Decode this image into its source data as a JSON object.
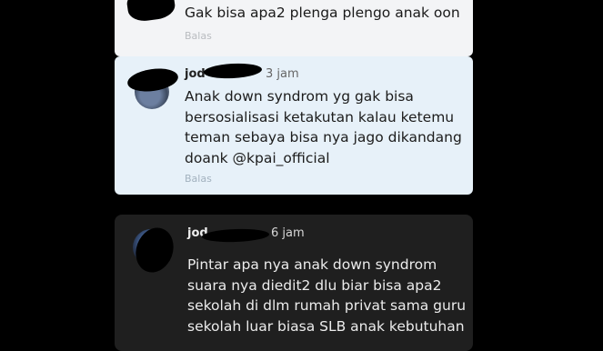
{
  "comments": [
    {
      "name": "",
      "time": "",
      "text": "Gak bisa apa2 plenga plengo anak oon",
      "reply_label": "Balas"
    },
    {
      "name": "jod",
      "time": "3 jam",
      "text": "Anak down syndrom yg gak bisa\nbersosialisasi ketakutan kalau ketemu\nteman sebaya bisa nya jago dikandang\ndoank @kpai_official",
      "reply_label": "Balas"
    },
    {
      "name": "jod",
      "time": "6 jam",
      "text": "Pintar apa nya anak down syndrom\nsuara nya diedit2 dlu biar bisa apa2\nsekolah di dlm rumah privat sama guru\nsekolah luar biasa SLB anak kebutuhan",
      "reply_label": ""
    }
  ],
  "colors": {
    "background": "#000000",
    "card_plain": "#f3f4f6",
    "card_highlight": "#e7f1f9",
    "card_dark": "#1f1f1f"
  }
}
